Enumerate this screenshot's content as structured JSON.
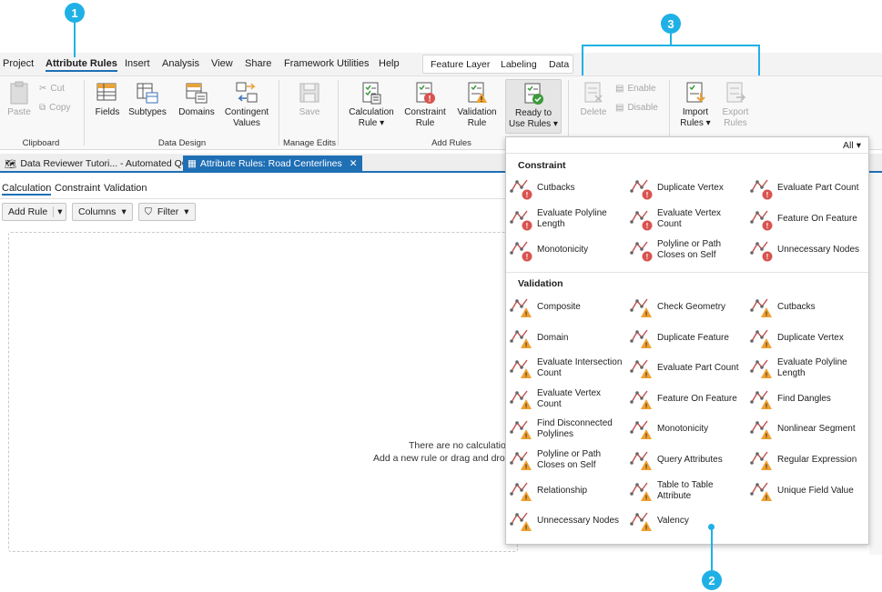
{
  "callouts": [
    "1",
    "2",
    "3"
  ],
  "menu": {
    "tabs": [
      "Project",
      "Attribute Rules",
      "Insert",
      "Analysis",
      "View",
      "Share",
      "Framework Utilities",
      "Help"
    ],
    "context_tabs": [
      "Feature Layer",
      "Labeling",
      "Data"
    ]
  },
  "ribbon": {
    "clipboard": {
      "paste": "Paste",
      "cut": "Cut",
      "copy": "Copy",
      "group": "Clipboard"
    },
    "data_design": {
      "fields": "Fields",
      "subtypes": "Subtypes",
      "domains": "Domains",
      "contingent_values": "Contingent Values",
      "group": "Data Design"
    },
    "manage_edits": {
      "save": "Save",
      "group": "Manage Edits"
    },
    "add_rules": {
      "calculation": "Calculation Rule",
      "constraint": "Constraint Rule",
      "validation": "Validation Rule",
      "ready": "Ready to Use Rules",
      "group": "Add Rules"
    },
    "rule_tools": {
      "delete": "Delete",
      "enable": "Enable",
      "disable": "Disable",
      "import": "Import Rules",
      "export": "Export Rules"
    }
  },
  "doc_tabs": [
    {
      "label": "Data Reviewer Tutori... - Automated QC"
    },
    {
      "label": "Attribute Rules: Road Centerlines"
    }
  ],
  "view": {
    "subtabs": [
      "Calculation",
      "Constraint",
      "Validation"
    ],
    "add_rule": "Add Rule",
    "columns": "Columns",
    "filter": "Filter",
    "empty_line1": "There are no calculation r",
    "empty_line2": "Add a new rule or drag and drop a"
  },
  "dropdown": {
    "filter_value": "All",
    "constraint_header": "Constraint",
    "validation_header": "Validation",
    "constraint_items": [
      "Cutbacks",
      "Duplicate Vertex",
      "Evaluate Part Count",
      "Evaluate Polyline Length",
      "Evaluate Vertex Count",
      "Feature On Feature",
      "Monotonicity",
      "Polyline or Path Closes on Self",
      "Unnecessary Nodes"
    ],
    "validation_items": [
      "Composite",
      "Check Geometry",
      "Cutbacks",
      "Domain",
      "Duplicate Feature",
      "Duplicate Vertex",
      "Evaluate Intersection Count",
      "Evaluate Part Count",
      "Evaluate Polyline Length",
      "Evaluate Vertex Count",
      "Feature On Feature",
      "Find Dangles",
      "Find Disconnected Polylines",
      "Monotonicity",
      "Nonlinear Segment",
      "Polyline or Path Closes on Self",
      "Query Attributes",
      "Regular Expression",
      "Relationship",
      "Table to Table Attribute",
      "Unique Field Value",
      "Unnecessary Nodes",
      "Valency"
    ]
  },
  "colors": {
    "accent": "#1f6fb5",
    "callout": "#1fb1e6",
    "error_badge": "#d9534f",
    "warning_badge": "#f0a030"
  }
}
